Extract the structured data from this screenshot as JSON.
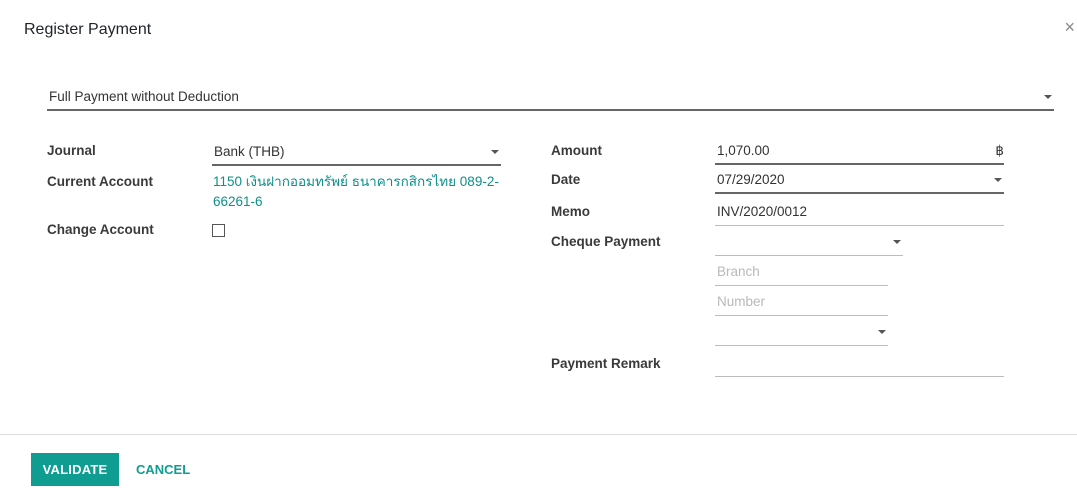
{
  "dialog": {
    "title": "Register Payment",
    "close_glyph": "×"
  },
  "payment_type": {
    "value": "Full Payment without Deduction"
  },
  "left": {
    "journal_label": "Journal",
    "journal_value": "Bank (THB)",
    "current_account_label": "Current Account",
    "current_account_value": "1150 เงินฝากออมทรัพย์ ธนาคารกสิกรไทย 089-2-66261-6",
    "change_account_label": "Change Account",
    "change_account_checked": false
  },
  "right": {
    "amount_label": "Amount",
    "amount_value": "1,070.00",
    "currency_symbol": "฿",
    "date_label": "Date",
    "date_value": "07/29/2020",
    "memo_label": "Memo",
    "memo_value": "INV/2020/0012",
    "cheque_payment_label": "Cheque Payment",
    "cheque_payment_value": "",
    "branch_placeholder": "Branch",
    "number_placeholder": "Number",
    "extra_select_value": "",
    "payment_remark_label": "Payment Remark",
    "payment_remark_value": ""
  },
  "footer": {
    "validate_label": "VALIDATE",
    "cancel_label": "CANCEL"
  },
  "colors": {
    "accent": "#0f9d92",
    "link": "#0e8f8a"
  }
}
